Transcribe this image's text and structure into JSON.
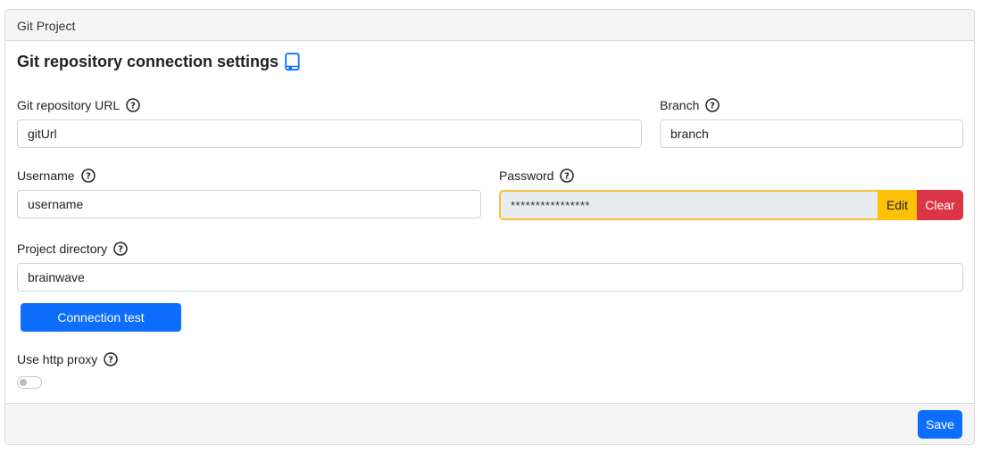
{
  "card": {
    "header_title": "Git Project"
  },
  "section": {
    "title": "Git repository connection settings",
    "title_icon": "book-bookmark-icon"
  },
  "fields": {
    "git_url": {
      "label": "Git repository URL",
      "value": "gitUrl"
    },
    "branch": {
      "label": "Branch",
      "value": "branch"
    },
    "username": {
      "label": "Username",
      "value": "username"
    },
    "password": {
      "label": "Password",
      "value": "****************",
      "edit_label": "Edit",
      "clear_label": "Clear"
    },
    "project_directory": {
      "label": "Project directory",
      "value": "brainwave"
    }
  },
  "connection_test_label": "Connection test",
  "http_proxy": {
    "label": "Use http proxy",
    "enabled": false
  },
  "footer": {
    "save_label": "Save"
  },
  "colors": {
    "primary": "#0d6efd",
    "warning": "#ffc107",
    "danger": "#dc3545",
    "focus_border": "#f5c23a"
  }
}
